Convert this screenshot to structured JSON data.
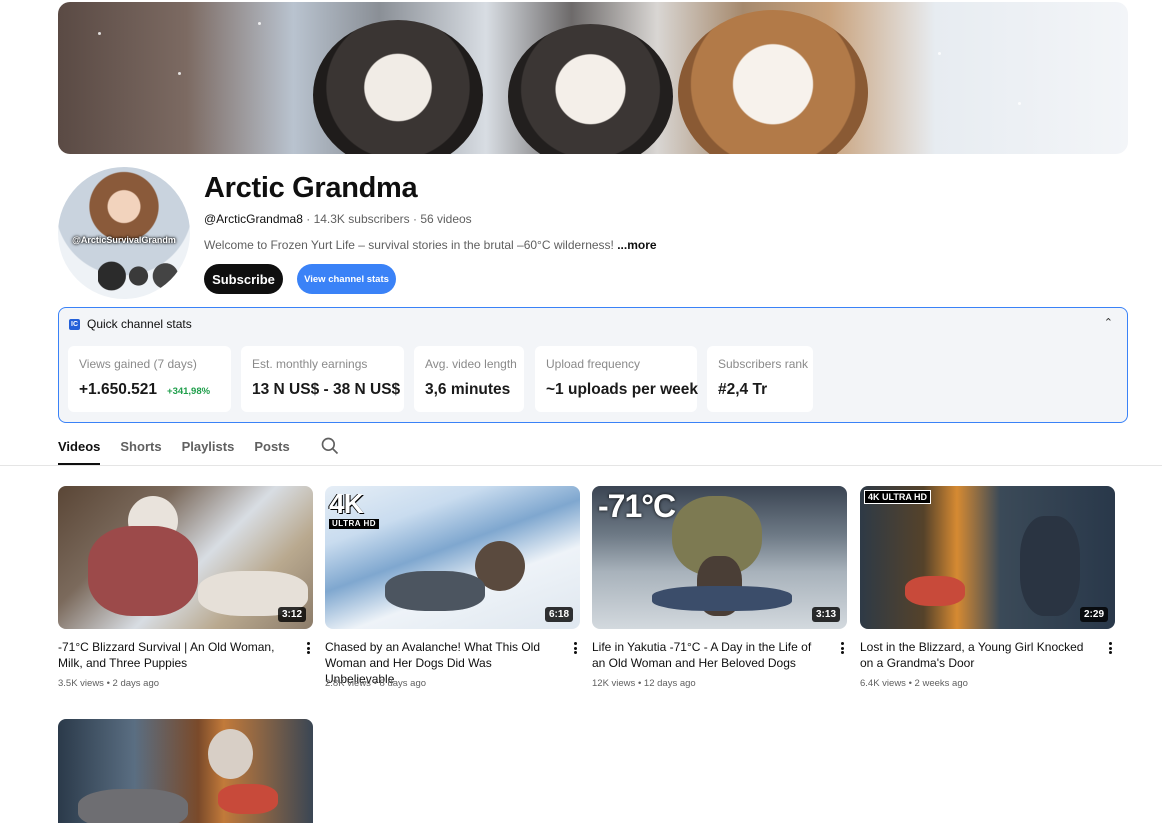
{
  "channel": {
    "name": "Arctic Grandma",
    "handle": "@ArcticGrandma8",
    "subscribers": "14.3K subscribers",
    "videos_count": "56 videos",
    "description": "Welcome to Frozen Yurt Life – survival stories in the brutal –60°C wilderness! ",
    "more_label": "...more",
    "avatar_caption": "@ArcticSurvivalGrandm",
    "subscribe_label": "Subscribe",
    "view_stats_label": "View channel stats"
  },
  "quick_stats": {
    "title": "Quick channel stats",
    "logo": "IC",
    "cards": [
      {
        "label": "Views gained (7 days)",
        "value": "+1.650.521",
        "delta": "+341,98%"
      },
      {
        "label": "Est. monthly earnings",
        "value": "13 N US$ - 38 N US$"
      },
      {
        "label": "Avg. video length",
        "value": "3,6 minutes"
      },
      {
        "label": "Upload frequency",
        "value": "~1 uploads per week"
      },
      {
        "label": "Subscribers rank",
        "value": "#2,4 Tr"
      }
    ]
  },
  "tabs": {
    "videos": "Videos",
    "shorts": "Shorts",
    "playlists": "Playlists",
    "posts": "Posts"
  },
  "videos": [
    {
      "title": "-71°C Blizzard Survival | An Old Woman, Milk, and Three Puppies",
      "views": "3.5K views",
      "age": "2 days ago",
      "duration": "3:12"
    },
    {
      "title": "Chased by an Avalanche! What This Old Woman and Her Dogs Did Was Unbelievable",
      "views": "2.8K views",
      "age": "8 days ago",
      "duration": "6:18",
      "badge_big": "4K",
      "badge_small": "ULTRA HD"
    },
    {
      "title": "Life in Yakutia -71°C - A Day in the Life of an Old Woman and Her Beloved Dogs",
      "views": "12K views",
      "age": "12 days ago",
      "duration": "3:13",
      "overlay": "-71°C"
    },
    {
      "title": "Lost in the Blizzard, a Young Girl Knocked on a Grandma's Door",
      "views": "6.4K views",
      "age": "2 weeks ago",
      "duration": "2:29",
      "badge_inline": "4K ULTRA HD"
    },
    {
      "title": "",
      "views": "",
      "age": "",
      "duration": ""
    }
  ]
}
